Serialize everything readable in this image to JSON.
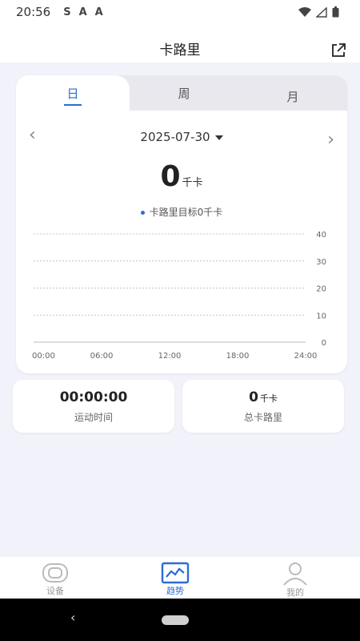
{
  "status": {
    "time": "20:56",
    "icons": [
      "S",
      "A",
      "A"
    ]
  },
  "header": {
    "title": "卡路里"
  },
  "tabs": [
    {
      "label": "日",
      "active": true
    },
    {
      "label": "周",
      "active": false
    },
    {
      "label": "月",
      "active": false
    }
  ],
  "date": {
    "value": "2025-07-30"
  },
  "calories": {
    "value": "0",
    "unit": "千卡"
  },
  "goal": {
    "text": "卡路里目标0千卡"
  },
  "chart_data": {
    "type": "bar",
    "title": "",
    "x_ticks": [
      "00:00",
      "06:00",
      "12:00",
      "18:00",
      "24:00"
    ],
    "y_ticks": [
      "40",
      "30",
      "20",
      "10",
      "0"
    ],
    "ylim": [
      0,
      40
    ],
    "grid": true,
    "values": []
  },
  "stats": {
    "duration": {
      "value": "00:00:00",
      "label": "运动时间"
    },
    "total": {
      "value": "0",
      "unit": "千卡",
      "label": "总卡路里"
    }
  },
  "nav": {
    "device": "设备",
    "trend": "趋势",
    "mine": "我的",
    "active": "trend"
  },
  "colors": {
    "accent": "#2a6dd6",
    "background": "#f2f2fb"
  }
}
